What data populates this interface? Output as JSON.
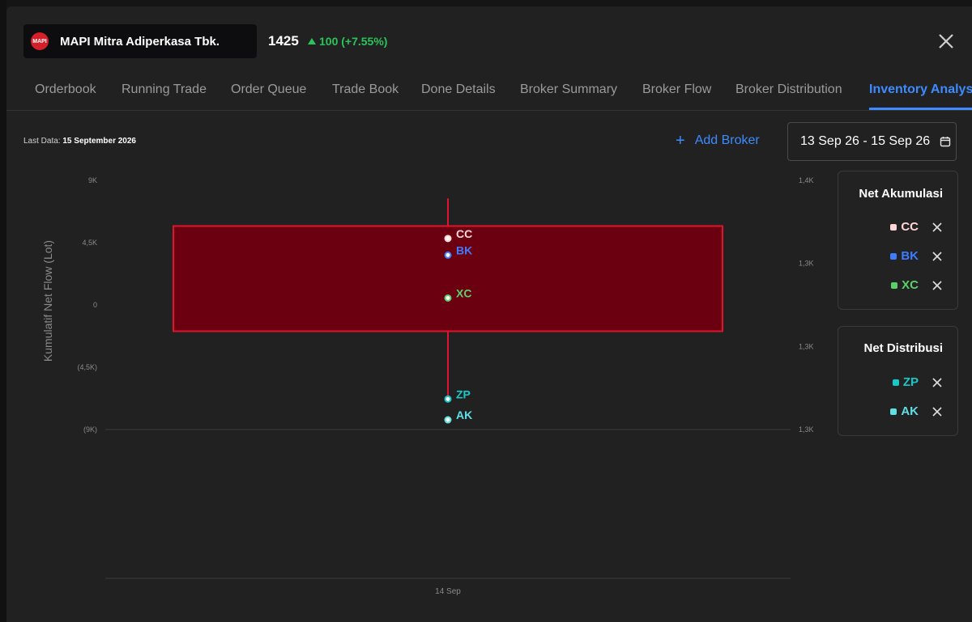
{
  "header": {
    "logo_text": "MAPI",
    "stock_name": "MAPI Mitra Adiperkasa Tbk.",
    "price": "1425",
    "change": "100 (+7.55%)"
  },
  "tabs": [
    {
      "label": "Orderbook"
    },
    {
      "label": "Running Trade"
    },
    {
      "label": "Order Queue"
    },
    {
      "label": "Trade Book"
    },
    {
      "label": "Done Details"
    },
    {
      "label": "Broker Summary"
    },
    {
      "label": "Broker Flow"
    },
    {
      "label": "Broker Distribution"
    },
    {
      "label": "Inventory Analysis"
    }
  ],
  "toolbar": {
    "last_data_label": "Last Data:",
    "last_data_value": "15 September 2026",
    "add_broker": "Add Broker",
    "date_range": "13 Sep 26 - 15 Sep 26"
  },
  "colors": {
    "accent": "#3d8bff",
    "up": "#2bc45a",
    "candle_fill": "#6b0010",
    "candle_border": "#e0142c"
  },
  "legend": {
    "accumulation_title": "Net Akumulasi",
    "distribution_title": "Net Distribusi",
    "accumulation": [
      {
        "code": "CC",
        "color": "#ffd6d6"
      },
      {
        "code": "BK",
        "color": "#3d7bff"
      },
      {
        "code": "XC",
        "color": "#5ccf6b"
      }
    ],
    "distribution": [
      {
        "code": "ZP",
        "color": "#18c8c8"
      },
      {
        "code": "AK",
        "color": "#5ee0e6"
      }
    ]
  },
  "chart_data": {
    "type": "scatter",
    "ylabel": "Kumulatif Net Flow (Lot)",
    "x_ticks": [
      "14 Sep"
    ],
    "y_left_ticks": [
      "9K",
      "4,5K",
      "0",
      "(4,5K)",
      "(9K)"
    ],
    "y_right_ticks": [
      "1,4K",
      "1,3K",
      "1,3K",
      "1,3K"
    ],
    "ylim": [
      -9000,
      9000
    ],
    "candle": {
      "x": "14 Sep",
      "high": 7700,
      "box_top": 5700,
      "box_bottom": -1900,
      "low": -7000
    },
    "series": [
      {
        "name": "CC",
        "color": "#ffd6d6",
        "x": "14 Sep",
        "y": 4800
      },
      {
        "name": "BK",
        "color": "#3d7bff",
        "x": "14 Sep",
        "y": 3600
      },
      {
        "name": "XC",
        "color": "#5ccf6b",
        "x": "14 Sep",
        "y": 500
      },
      {
        "name": "ZP",
        "color": "#18c8c8",
        "x": "14 Sep",
        "y": -6800
      },
      {
        "name": "AK",
        "color": "#5ee0e6",
        "x": "14 Sep",
        "y": -8300
      }
    ]
  }
}
